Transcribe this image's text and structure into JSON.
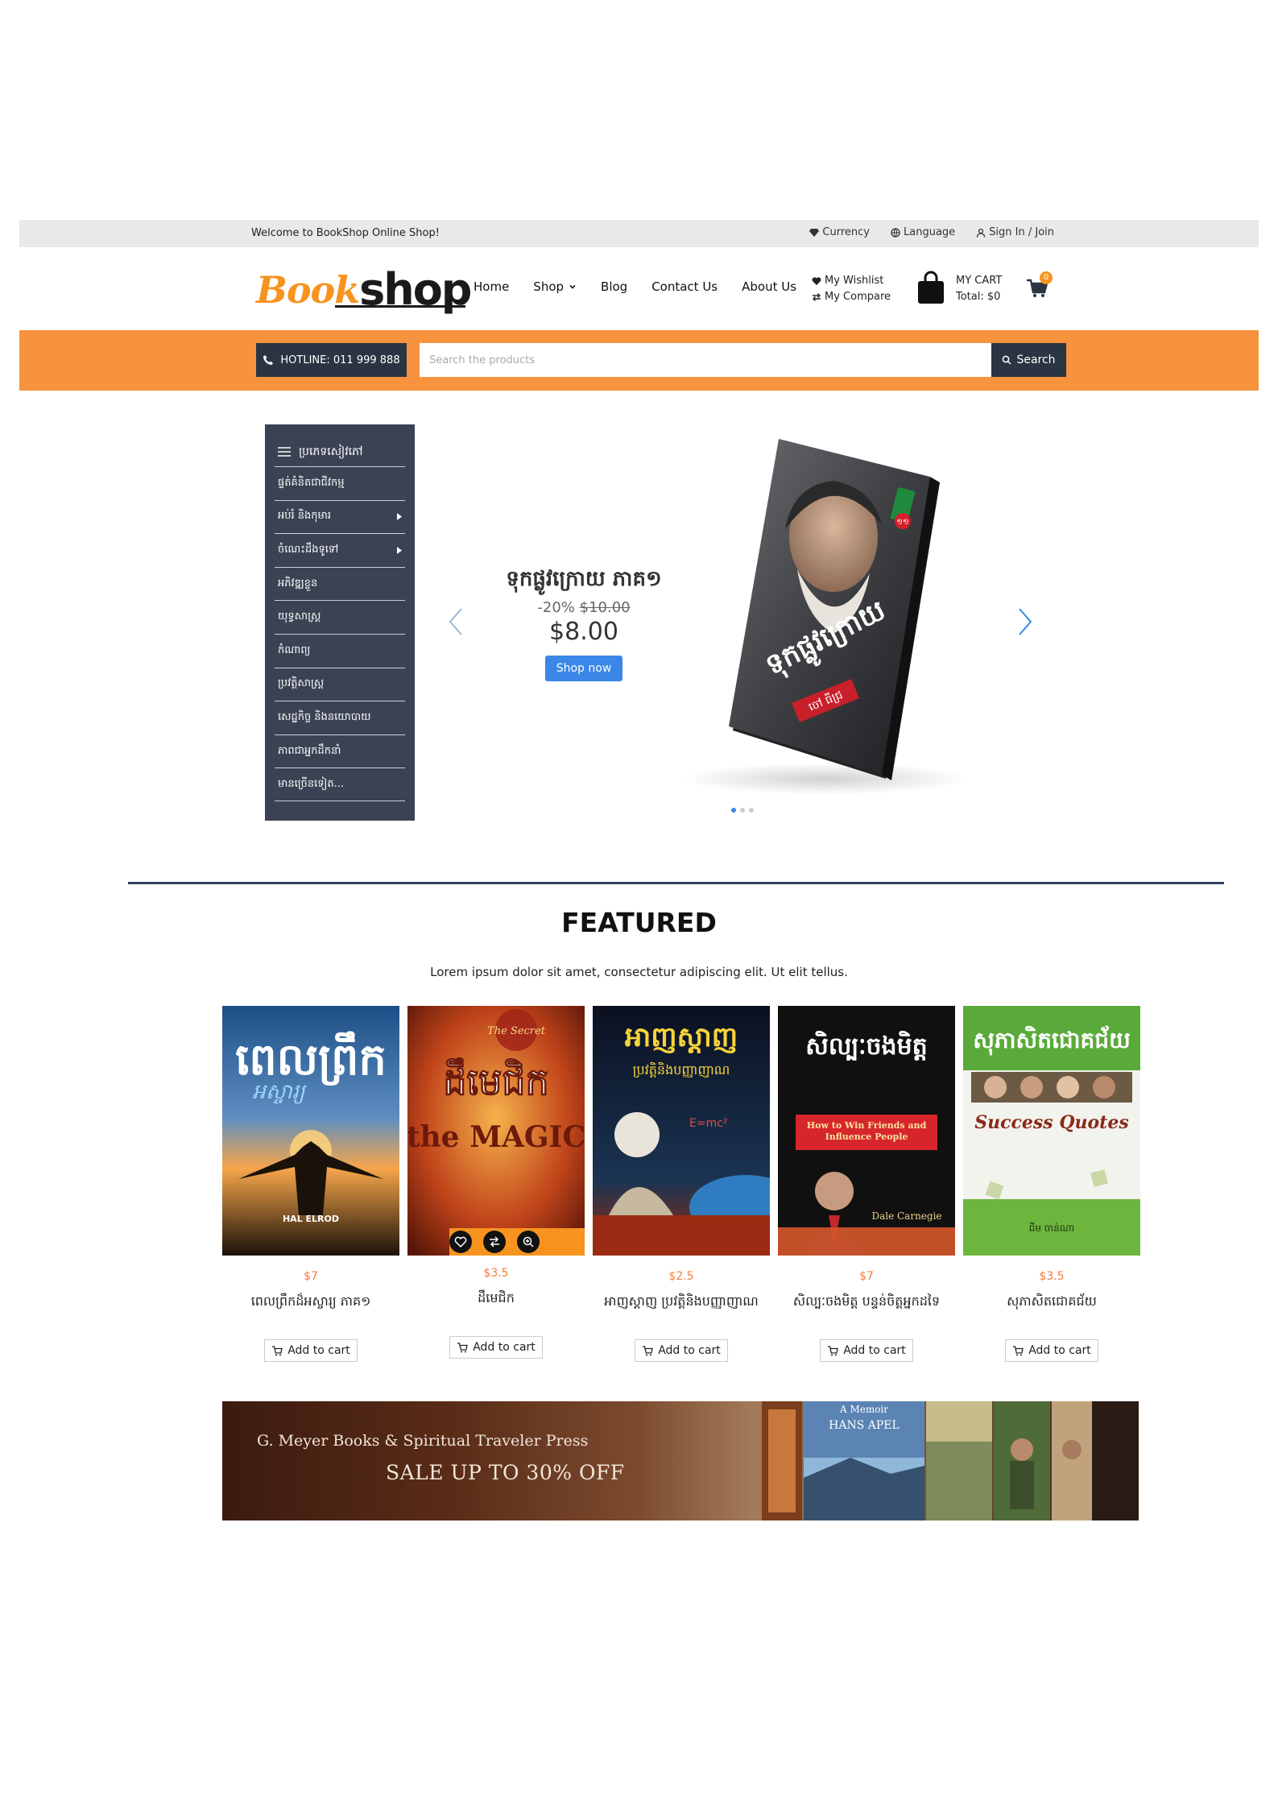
{
  "topbar": {
    "welcome": "Welcome to BookShop Online Shop!",
    "currency": "Currency",
    "language": "Language",
    "signin": "Sign In / Join"
  },
  "header": {
    "logo_book": "Book",
    "logo_shop": "shop",
    "nav": [
      "Home",
      "Shop",
      "Blog",
      "Contact Us",
      "About Us"
    ],
    "wishlist": "My Wishlist",
    "compare": "My Compare",
    "cart_label": "MY CART",
    "cart_total": "Total: $0",
    "cart_count": "0"
  },
  "searchbar": {
    "hotline": "HOTLINE: 011 999 888",
    "placeholder": "Search the products",
    "button": "Search"
  },
  "sidebar": {
    "title": "ប្រភេទសៀវភៅ",
    "categories": [
      {
        "label": "ផ្ទត់គំនិតជាជីវកម្ម",
        "sub": false
      },
      {
        "label": "អប់រំ និងកុមារ",
        "sub": true
      },
      {
        "label": "ចំណេះដឹងទូទៅ",
        "sub": true
      },
      {
        "label": "អភិវឌ្ឍខ្លួន",
        "sub": false
      },
      {
        "label": "យុទ្ធសាស្ត្រ",
        "sub": false
      },
      {
        "label": "កំណាព្យ",
        "sub": false
      },
      {
        "label": "ប្រវត្តិសាស្ត្រ",
        "sub": false
      },
      {
        "label": "សេដ្ឋកិច្ច និងនយោបាយ",
        "sub": false
      },
      {
        "label": "ភាពជាអ្នកដឹកនាំ",
        "sub": false
      },
      {
        "label": "មានច្រើនទៀត...",
        "sub": false
      }
    ]
  },
  "slider": {
    "title": "ទុកផ្លូវក្រោយ ភាគ១",
    "discount": "-20%",
    "old_price": "$10.00",
    "price": "$8.00",
    "button": "Shop now",
    "book_title": "ទុកផ្លូវក្រោយ",
    "book_badge": "១១",
    "book_author": "ចៅ ធីជ្រ",
    "accent": "#3b87e8"
  },
  "featured": {
    "title": "FEATURED",
    "subtitle": "Lorem ipsum dolor sit amet, consectetur adipiscing elit. Ut elit tellus.",
    "add_label": "Add to cart",
    "products": [
      {
        "price": "$7",
        "name": "ពេលព្រឹកដ៏អស្ចារ្យ ភាគ១",
        "cover_title": "ពេលព្រឹក",
        "cover_sub": "អស្ចារ្យ",
        "cover_author": "HAL ELROD"
      },
      {
        "price": "$3.5",
        "name": "ដឹមេជិក",
        "cover_title": "ដឹមេជិក",
        "cover_sub": "the MAGIC",
        "cover_author": "The Secret"
      },
      {
        "price": "$2.5",
        "name": "អាញស្តាញ ប្រវត្តិនិងបញ្ញាញាណ",
        "cover_title": "អាញស្តាញ",
        "cover_sub": "ប្រវត្តិនិងបញ្ញាញាណ",
        "cover_author": "E=mc²"
      },
      {
        "price": "$7",
        "name": "សិល្បៈចងមិត្ត បន្ទន់ចិត្តអ្នកដទៃ",
        "cover_title": "សិល្បៈចងមិត្ត",
        "cover_sub": "How to Win Friends and Influence People",
        "cover_author": "Dale Carnegie"
      },
      {
        "price": "$3.5",
        "name": "សុភាសិតជោគជ័យ",
        "cover_title": "សុភាសិតជោគជ័យ",
        "cover_sub": "Success Quotes",
        "cover_author": "ជីម ចាន់ណា"
      }
    ]
  },
  "banner": {
    "line1": "G. Meyer Books & Spiritual Traveler Press",
    "line2": "SALE UP TO 30% OFF",
    "memoir": "A Memoir",
    "author": "HANS APEL"
  },
  "colors": {
    "orange": "#f7933f",
    "dark": "#2b3442",
    "sidebar": "#3a4253",
    "price": "#f47c3c"
  }
}
